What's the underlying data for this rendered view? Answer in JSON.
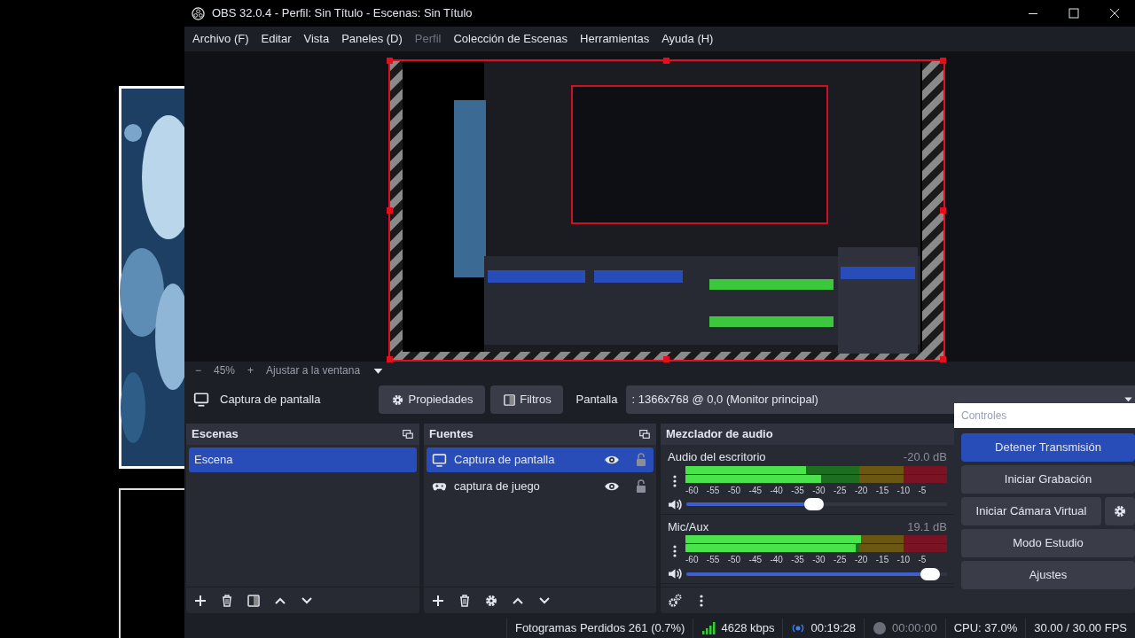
{
  "window": {
    "title": "OBS 32.0.4 - Perfil: Sin Título - Escenas: Sin Título"
  },
  "menu": [
    {
      "label": "Archivo (F)",
      "disabled": false
    },
    {
      "label": "Editar",
      "disabled": false
    },
    {
      "label": "Vista",
      "disabled": false
    },
    {
      "label": "Paneles (D)",
      "disabled": false
    },
    {
      "label": "Perfil",
      "disabled": true
    },
    {
      "label": "Colección de Escenas",
      "disabled": false
    },
    {
      "label": "Herramientas",
      "disabled": false
    },
    {
      "label": "Ayuda (H)",
      "disabled": false
    }
  ],
  "zoom_bar": {
    "minus": "−",
    "zoom": "45%",
    "plus": "+",
    "fit": "Ajustar a la ventana"
  },
  "source_toolbar": {
    "source": "Captura de pantalla",
    "properties": "Propiedades",
    "filters": "Filtros",
    "display_label": "Pantalla",
    "display_value": ": 1366x768 @ 0,0 (Monitor principal)"
  },
  "scenes": {
    "title": "Escenas",
    "items": [
      {
        "name": "Escena",
        "selected": true
      }
    ]
  },
  "sources": {
    "title": "Fuentes",
    "items": [
      {
        "name": "Captura de pantalla",
        "kind": "display",
        "selected": true,
        "visible": true,
        "locked": false
      },
      {
        "name": "captura de juego",
        "kind": "game",
        "selected": false,
        "visible": true,
        "locked": false
      }
    ]
  },
  "mixer": {
    "title": "Mezclador de audio",
    "channels": [
      {
        "name": "Audio del escritorio",
        "reading": "-20.0 dB",
        "scale": [
          "-60",
          "-55",
          "-50",
          "-45",
          "-40",
          "-35",
          "-30",
          "-25",
          "-20",
          "-15",
          "-10",
          "-5"
        ],
        "meters": [
          {
            "level": 0.46
          },
          {
            "level": 0.52
          }
        ],
        "volume": {
          "level": 0.49
        }
      },
      {
        "name": "Mic/Aux",
        "reading": "19.1 dB",
        "scale": [
          "-60",
          "-55",
          "-50",
          "-45",
          "-40",
          "-35",
          "-30",
          "-25",
          "-20",
          "-15",
          "-10",
          "-5"
        ],
        "meters": [
          {
            "level": 0.67
          },
          {
            "level": 0.65
          }
        ],
        "volume": {
          "level": 0.97
        }
      }
    ]
  },
  "controls": {
    "title": "Controles",
    "buttons": [
      {
        "label": "Detener Transmisión",
        "checked": true,
        "settings": false
      },
      {
        "label": "Iniciar Grabación",
        "checked": false,
        "settings": false
      },
      {
        "label": "Iniciar Cámara Virtual",
        "checked": false,
        "settings": true
      },
      {
        "label": "Modo Estudio",
        "checked": false,
        "settings": false
      },
      {
        "label": "Ajustes",
        "checked": false,
        "settings": false
      }
    ]
  },
  "status_bar": {
    "dropped_frames": "Fotogramas Perdidos 261 (0.7%)",
    "bitrate": "4628 kbps",
    "stream_time": "00:19:28",
    "record_time": "00:00:00",
    "cpu": "CPU: 37.0%",
    "fps": "30.00 / 30.00 FPS"
  }
}
